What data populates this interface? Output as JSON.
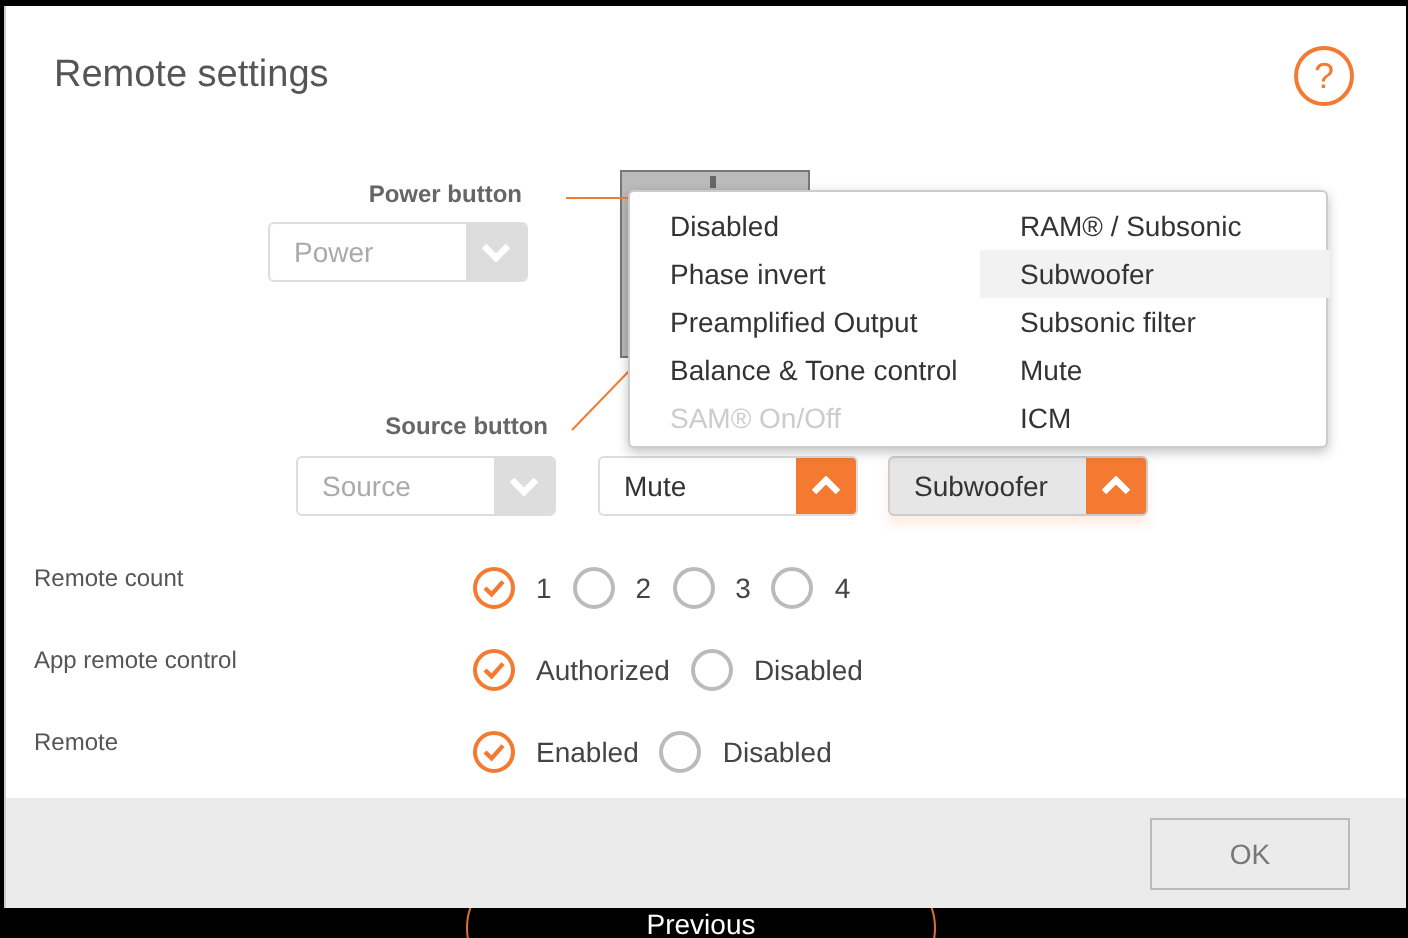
{
  "dialog": {
    "title": "Remote settings",
    "help": "?"
  },
  "remote": {
    "power_label": "Power button",
    "source_label": "Source button",
    "selects": [
      {
        "value": "Power",
        "enabled": false,
        "open": false
      },
      {
        "value": "Source",
        "enabled": false,
        "open": false
      },
      {
        "value": "Mute",
        "enabled": true,
        "open": false
      },
      {
        "value": "Subwoofer",
        "enabled": true,
        "open": true
      }
    ],
    "menu": [
      {
        "label": "Disabled",
        "disabled": false,
        "selected": false
      },
      {
        "label": "Phase invert",
        "disabled": false,
        "selected": false
      },
      {
        "label": "Preamplified Output",
        "disabled": false,
        "selected": false
      },
      {
        "label": "Balance & Tone control",
        "disabled": false,
        "selected": false
      },
      {
        "label": "SAM® On/Off",
        "disabled": true,
        "selected": false
      },
      {
        "label": "RAM® / Subsonic",
        "disabled": false,
        "selected": false
      },
      {
        "label": "Subwoofer",
        "disabled": false,
        "selected": true
      },
      {
        "label": "Subsonic filter",
        "disabled": false,
        "selected": false
      },
      {
        "label": "Mute",
        "disabled": false,
        "selected": false
      },
      {
        "label": "ICM",
        "disabled": false,
        "selected": false
      }
    ]
  },
  "settings": [
    {
      "label": "Remote count",
      "options": [
        {
          "label": "1",
          "selected": true
        },
        {
          "label": "2",
          "selected": false
        },
        {
          "label": "3",
          "selected": false
        },
        {
          "label": "4",
          "selected": false
        }
      ]
    },
    {
      "label": "App remote control",
      "options": [
        {
          "label": "Authorized",
          "selected": true
        },
        {
          "label": "Disabled",
          "selected": false
        }
      ]
    },
    {
      "label": "Remote",
      "options": [
        {
          "label": "Enabled",
          "selected": true
        },
        {
          "label": "Disabled",
          "selected": false
        }
      ]
    }
  ],
  "footer": {
    "ok": "OK"
  },
  "background": {
    "button": "Previous"
  }
}
